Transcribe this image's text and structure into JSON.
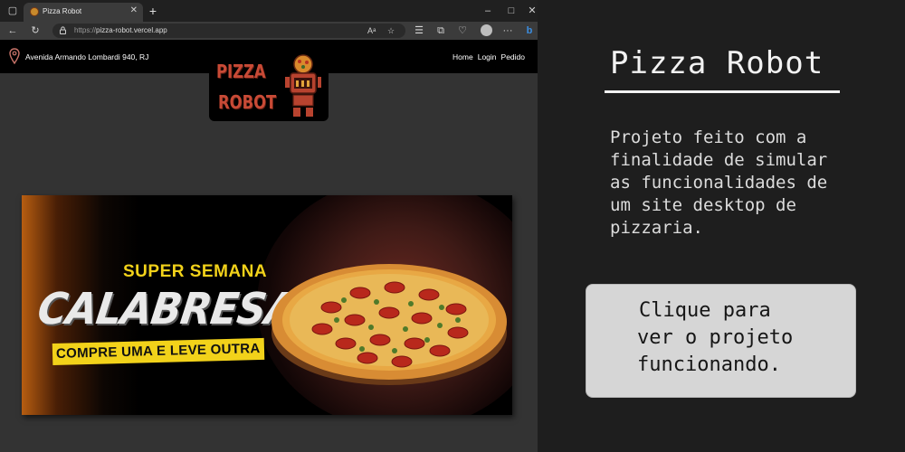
{
  "browser": {
    "tab_title": "Pizza Robot",
    "url_scheme": "https://",
    "url_host": "pizza-robot.vercel.app",
    "titlebar_controls": {
      "minimize": "–",
      "maximize": "□",
      "close": "✕"
    },
    "new_tab_label": "+",
    "toolbar_icons": [
      "back-icon",
      "refresh-icon",
      "read-aloud-icon",
      "favorites-star-icon",
      "collections-icon",
      "extensions-icon",
      "more-icon"
    ]
  },
  "site": {
    "address": "Avenida Armando Lombardi 940, RJ",
    "nav": [
      "Home",
      "Login",
      "Pedido"
    ],
    "logo": {
      "line1": "PIZZA",
      "line2": "ROBOT"
    },
    "banner": {
      "super": "SUPER SEMANA",
      "headline": "CALABRESA",
      "offer": "COMPRE UMA E LEVE OUTRA"
    }
  },
  "panel": {
    "title": "Pizza Robot",
    "description_lines": [
      "Projeto feito com a",
      "finalidade de simular",
      "as funcionalidades de",
      "um site desktop de",
      "pizzaria."
    ],
    "button_lines": [
      "Clique para",
      "ver o projeto",
      "funcionando."
    ]
  },
  "colors": {
    "page_bg": "#333333",
    "panel_bg": "#1e1e1e",
    "banner_yellow": "#f2d21a",
    "logo_red": "#c84a36",
    "button_bg": "#d6d6d6"
  }
}
